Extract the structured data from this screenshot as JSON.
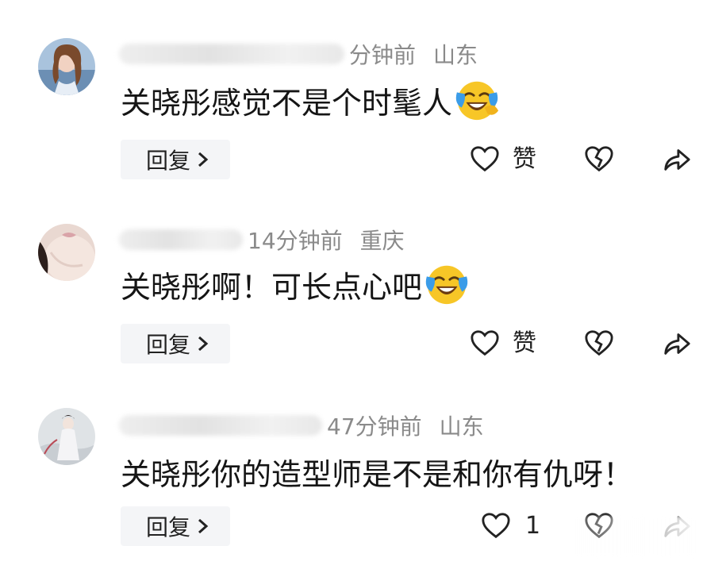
{
  "comments": [
    {
      "time": "分钟前",
      "location": "山东",
      "text": "关晓彤感觉不是个时髦人",
      "emoji": "laughing-crying-emoji",
      "reply_label": "回复",
      "like_label": "赞",
      "like_count": ""
    },
    {
      "time": "14分钟前",
      "location": "重庆",
      "text": "关晓彤啊！可长点心吧",
      "emoji": "laughing-crying-emoji",
      "reply_label": "回复",
      "like_label": "赞",
      "like_count": ""
    },
    {
      "time": "47分钟前",
      "location": "山东",
      "text": "关晓彤你的造型师是不是和你有仇呀！",
      "emoji": "",
      "reply_label": "回复",
      "like_label": "",
      "like_count": "1"
    }
  ],
  "icons": {
    "like": "heart-outline-icon",
    "dislike": "broken-heart-icon",
    "share": "share-arrow-icon",
    "reply_chevron": "chevron-right-icon"
  },
  "colors": {
    "meta_text": "#8a8a8a",
    "reply_bg": "#f4f5f7",
    "emoji_yellow": "#f7c627",
    "tear_blue": "#3b9ce8"
  }
}
